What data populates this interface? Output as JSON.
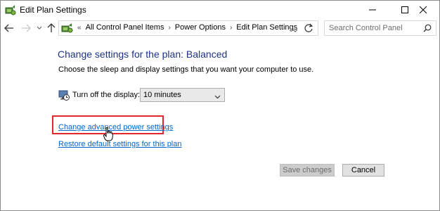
{
  "window": {
    "title": "Edit Plan Settings",
    "icon": "power-plan-icon"
  },
  "nav": {
    "breadcrumb_prefix": "«",
    "breadcrumbs": [
      "All Control Panel Items",
      "Power Options",
      "Edit Plan Settings"
    ],
    "separator": "›"
  },
  "search": {
    "placeholder": "Search Control Panel"
  },
  "content": {
    "heading": "Change settings for the plan: Balanced",
    "subtitle": "Choose the sleep and display settings that you want your computer to use.",
    "display_label": "Turn off the display:",
    "display_value": "10 minutes",
    "link_advanced": "Change advanced power settings",
    "link_restore": "Restore default settings for this plan"
  },
  "buttons": {
    "save": "Save changes",
    "cancel": "Cancel"
  },
  "colors": {
    "heading": "#1e3287",
    "link": "#0066cc",
    "highlight": "#e0282d"
  }
}
